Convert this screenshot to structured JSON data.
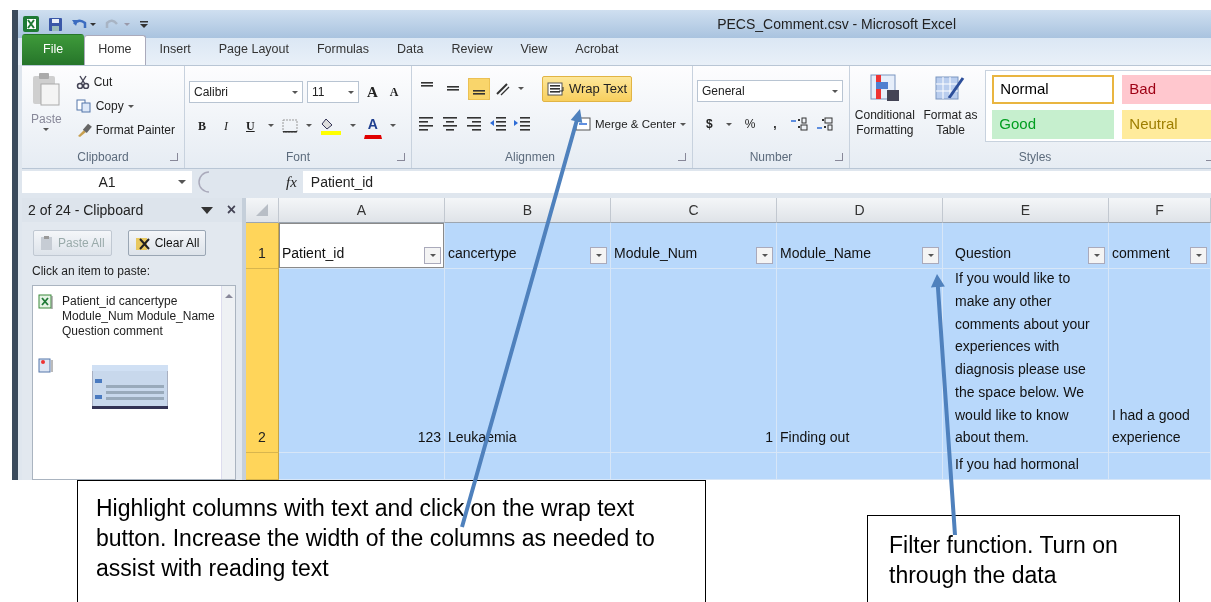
{
  "window": {
    "title": "PECS_Comment.csv - Microsoft Excel"
  },
  "ribbon_tabs": [
    {
      "label": "File",
      "kind": "file",
      "selected": false
    },
    {
      "label": "Home",
      "kind": "tab",
      "selected": true
    },
    {
      "label": "Insert",
      "kind": "tab",
      "selected": false
    },
    {
      "label": "Page Layout",
      "kind": "tab",
      "selected": false
    },
    {
      "label": "Formulas",
      "kind": "tab",
      "selected": false
    },
    {
      "label": "Data",
      "kind": "tab",
      "selected": false
    },
    {
      "label": "Review",
      "kind": "tab",
      "selected": false
    },
    {
      "label": "View",
      "kind": "tab",
      "selected": false
    },
    {
      "label": "Acrobat",
      "kind": "tab",
      "selected": false
    }
  ],
  "clipboard_group": {
    "label": "Clipboard",
    "paste": "Paste",
    "cut": "Cut",
    "copy": "Copy",
    "format_painter": "Format Painter"
  },
  "font_group": {
    "label": "Font",
    "font_name": "Calibri",
    "font_size": "11",
    "grow": "A",
    "shrink": "A",
    "bold": "B",
    "italic": "I",
    "underline": "U",
    "font_color": "A"
  },
  "alignment_group": {
    "label": "Alignmen",
    "vertical_align": [
      {
        "selected": false
      },
      {
        "selected": false
      },
      {
        "selected": true
      }
    ],
    "wrap_text": {
      "label": "Wrap Text",
      "on": true
    },
    "merge": "Merge & Center"
  },
  "number_group": {
    "label": "Number",
    "format": "General",
    "currency": "$",
    "percent": "%",
    "comma": ","
  },
  "styles_group": {
    "label": "Styles",
    "conditional": "Conditional Formatting",
    "format_table": "Format as Table",
    "styles": [
      {
        "label": "Normal",
        "color": "#ffffff",
        "selected": true
      },
      {
        "label": "Bad",
        "color": "#ffc7ce",
        "selected": false
      },
      {
        "label": "Good",
        "color": "#c6efce",
        "selected": false
      },
      {
        "label": "Neutral",
        "color": "#ffeb9c",
        "selected": false
      }
    ]
  },
  "formula_bar": {
    "name_box": "A1",
    "fx": "fx",
    "formula": "Patient_id"
  },
  "clipboard_pane": {
    "title": "2 of 24 - Clipboard",
    "close": "×",
    "paste_all": {
      "label": "Paste All",
      "disabled": true
    },
    "clear_all": {
      "label": "Clear All",
      "disabled": false
    },
    "hint": "Click an item to paste:",
    "items": [
      {
        "kind": "text",
        "text": "Patient_id cancertype Module_Num Module_Name Question comment"
      },
      {
        "kind": "picture"
      }
    ]
  },
  "sheet": {
    "columns": [
      "A",
      "B",
      "C",
      "D",
      "E",
      "F"
    ],
    "rows": [
      {
        "header": "1",
        "selected": true,
        "kind": "header",
        "cells": [
          {
            "text": "Patient_id",
            "active": true
          },
          {
            "text": "cancertype",
            "active": false
          },
          {
            "text": "Module_Num",
            "active": false
          },
          {
            "text": "Module_Name",
            "active": false
          },
          {
            "text": "Question",
            "active": false
          },
          {
            "text": "comment",
            "active": false
          }
        ]
      },
      {
        "header": "2",
        "selected": true,
        "kind": "data",
        "cells": [
          {
            "text": "123",
            "kind": "number",
            "active": false
          },
          {
            "text": "Leukaemia",
            "active": false
          },
          {
            "text": "1",
            "kind": "number",
            "active": false
          },
          {
            "text": "Finding out",
            "active": false
          },
          {
            "text": "If you would like to make any other comments about your experiences with diagnosis please use the space below.  We would like to know about them.",
            "active": false
          },
          {
            "text": "I had a good experience",
            "active": false
          }
        ]
      },
      {
        "selected": true,
        "kind": "data",
        "cells": [
          {
            "active": false
          },
          {
            "active": false
          },
          {
            "active": false
          },
          {
            "active": false
          },
          {
            "text": "If you had hormonal",
            "active": false
          },
          {
            "active": false
          }
        ]
      }
    ]
  },
  "callouts": [
    {
      "text": "Highlight columns with text and click on the wrap text button. Increase the width of the columns as needed to assist with reading text"
    },
    {
      "text": "Filter function. Turn on through the data"
    }
  ]
}
